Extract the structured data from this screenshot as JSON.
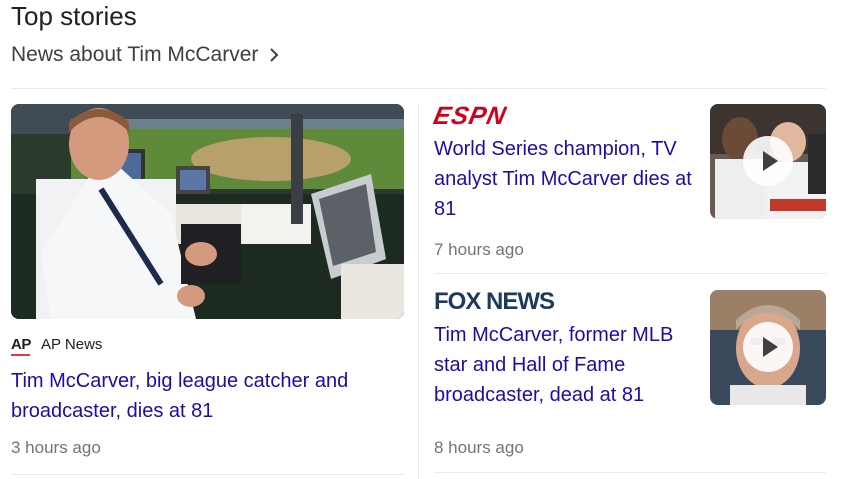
{
  "section": {
    "title": "Top stories",
    "more_link": "News about Tim McCarver"
  },
  "main_story": {
    "source": "AP News",
    "source_logo": "AP",
    "headline": "Tim McCarver, big league catcher and broadcaster, dies at 81",
    "time": "3 hours ago"
  },
  "side_stories": [
    {
      "source_logo": "ESPN",
      "headline": "World Series champion, TV analyst Tim McCarver dies at 81",
      "time": "7 hours ago",
      "thumbnail_has_play": true
    },
    {
      "source_logo": "FOX NEWS",
      "headline": "Tim McCarver, former MLB star and Hall of Fame broadcaster, dead at 81",
      "time": "8 hours ago",
      "thumbnail_has_play": true
    }
  ],
  "colors": {
    "link": "#1a0dab",
    "meta": "#70757a",
    "espn_red": "#d0021b",
    "fox_navy": "#1b3a5c",
    "ap_red": "#e03a3e"
  }
}
